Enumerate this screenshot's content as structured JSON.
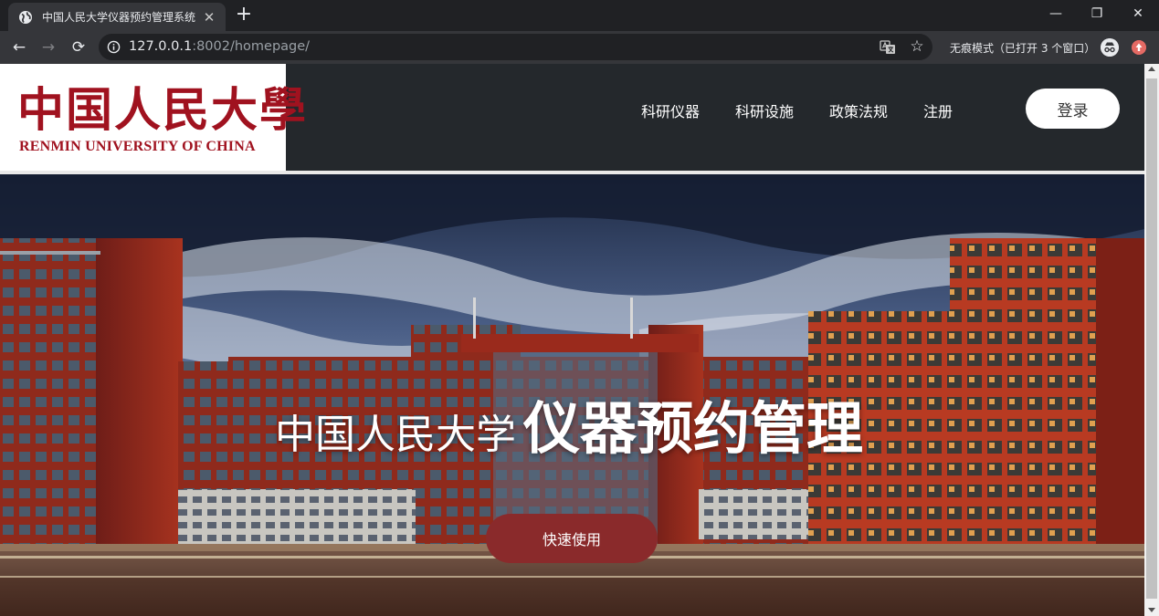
{
  "browser": {
    "tab_title": "中国人民大学仪器预约管理系统",
    "tab_close": "✕",
    "new_tab": "+",
    "url_host": "127.0.0.1",
    "url_rest": ":8002/homepage/",
    "incognito_text": "无痕模式（已打开 3 个窗口）",
    "window_controls": {
      "minimize": "—",
      "restore": "❐",
      "close": "✕"
    },
    "nav": {
      "back": "←",
      "forward": "→",
      "reload": "⟳"
    },
    "star": "☆"
  },
  "logo": {
    "chinese": "中国人民大學",
    "english": "RENMIN UNIVERSITY OF CHINA"
  },
  "nav": {
    "items": [
      "科研仪器",
      "科研设施",
      "政策法规",
      "注册"
    ],
    "login_label": "登录"
  },
  "hero": {
    "title_light": "中国人民大学",
    "title_bold": "仪器预约管理",
    "cta_label": "快速使用"
  },
  "colors": {
    "brand_red": "#a0121f",
    "cta": "#8a2a2b",
    "header_bg": "#24282c"
  },
  "icons": [
    "globe-icon",
    "info-icon",
    "translate-icon",
    "star-icon",
    "incognito-icon",
    "extension-icon"
  ]
}
